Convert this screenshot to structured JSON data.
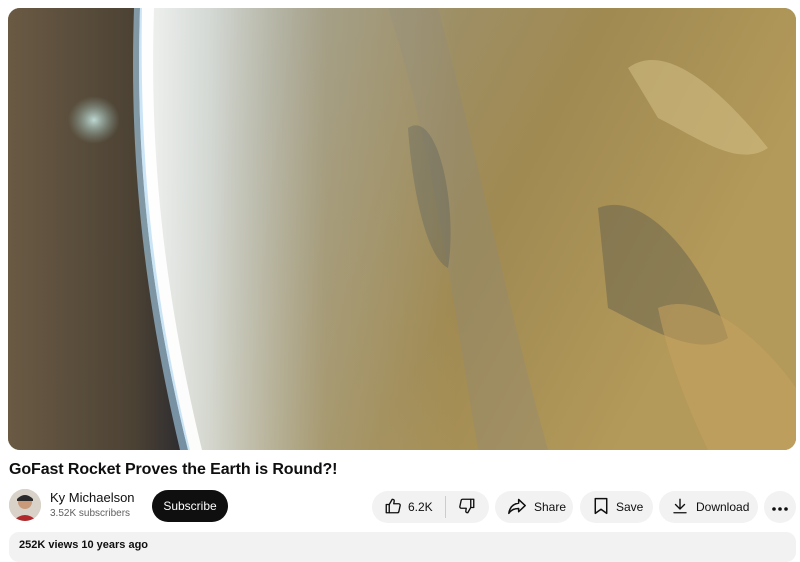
{
  "video": {
    "title": "GoFast Rocket Proves the Earth is Round?!",
    "thumbnail_desc": "earth-horizon-from-rocket"
  },
  "channel": {
    "name": "Ky Michaelson",
    "subscribers": "3.52K subscribers",
    "subscribe_label": "Subscribe"
  },
  "actions": {
    "like_count": "6.2K",
    "share_label": "Share",
    "save_label": "Save",
    "download_label": "Download"
  },
  "description": {
    "meta": "252K views  10 years ago"
  },
  "icons": [
    "like-icon",
    "dislike-icon",
    "share-icon",
    "save-icon",
    "download-icon",
    "more-icon"
  ]
}
